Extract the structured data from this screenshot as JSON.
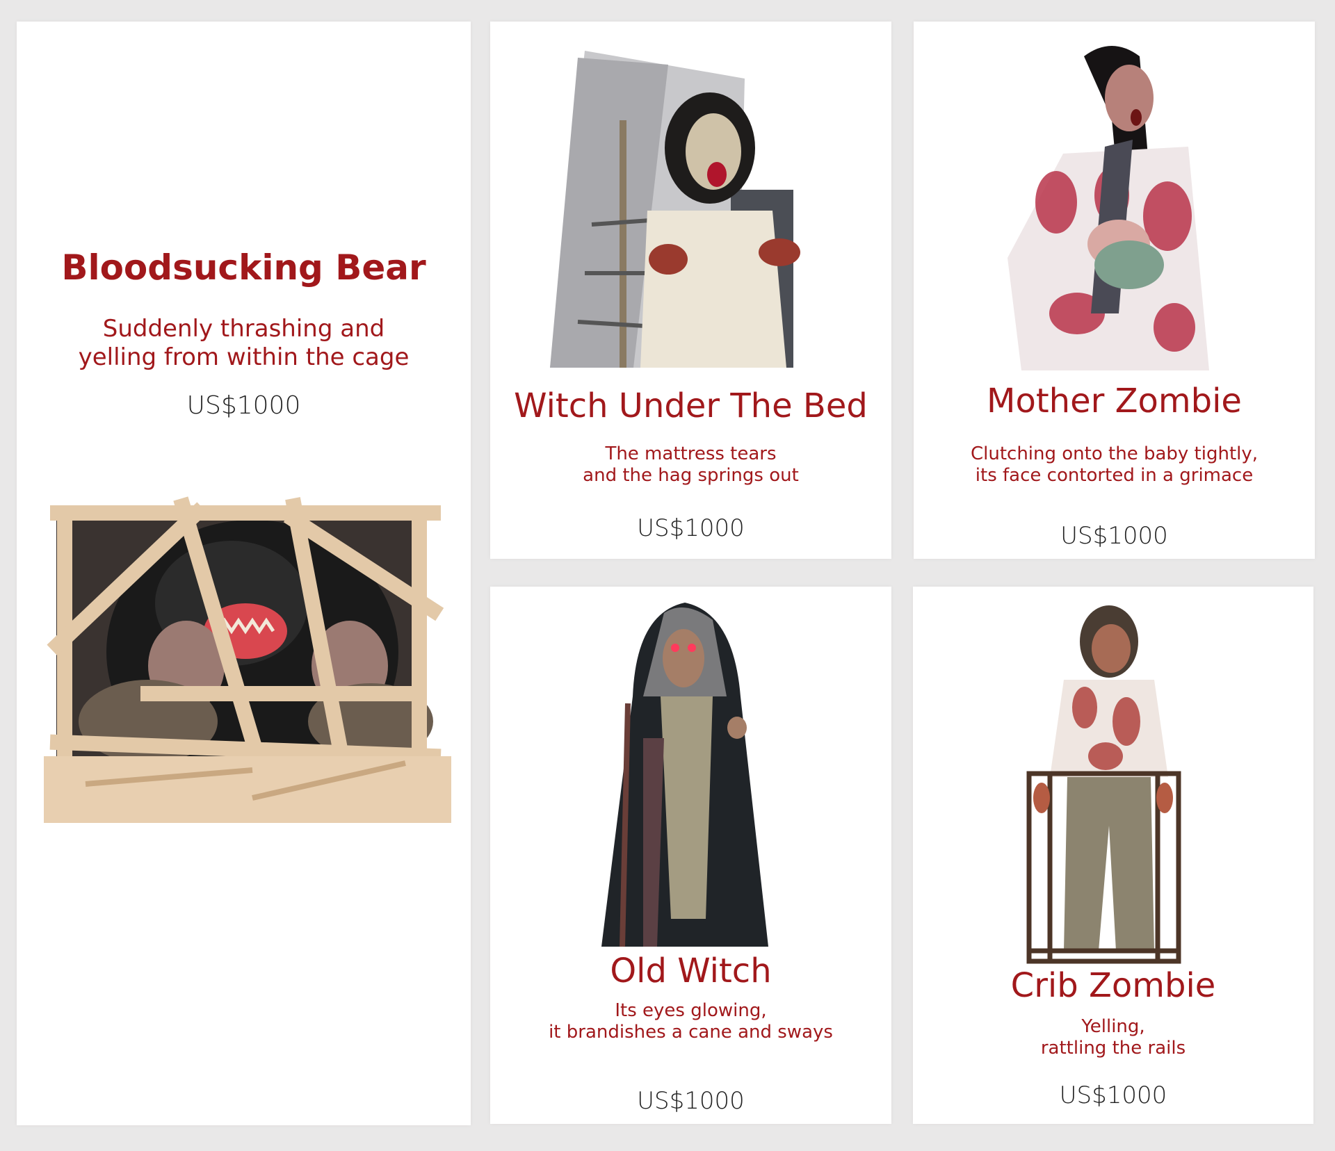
{
  "colors": {
    "background": "#e9e8e8",
    "card": "#ffffff",
    "accent": "#a1181b",
    "price": "#222222"
  },
  "products": [
    {
      "name": "Bloodsucking Bear",
      "description_lines": [
        "Suddenly thrashing and",
        "yelling from within the cage"
      ],
      "price": "US$1000",
      "image": "bear-in-cage-photo"
    },
    {
      "name": "Witch Under The Bed",
      "description_lines": [
        "The mattress tears",
        "and the hag springs out"
      ],
      "price": "US$1000",
      "image": "witch-bed-photo"
    },
    {
      "name": "Mother Zombie",
      "description_lines": [
        "Clutching onto the baby tightly,",
        "its face contorted in a grimace"
      ],
      "price": "US$1000",
      "image": "mother-zombie-photo"
    },
    {
      "name": "Old Witch",
      "description_lines": [
        "Its eyes glowing,",
        "it brandishes a cane and sways"
      ],
      "price": "US$1000",
      "image": "old-witch-photo"
    },
    {
      "name": "Crib Zombie",
      "description_lines": [
        "Yelling,",
        "rattling the rails"
      ],
      "price": "US$1000",
      "image": "crib-zombie-photo"
    }
  ]
}
